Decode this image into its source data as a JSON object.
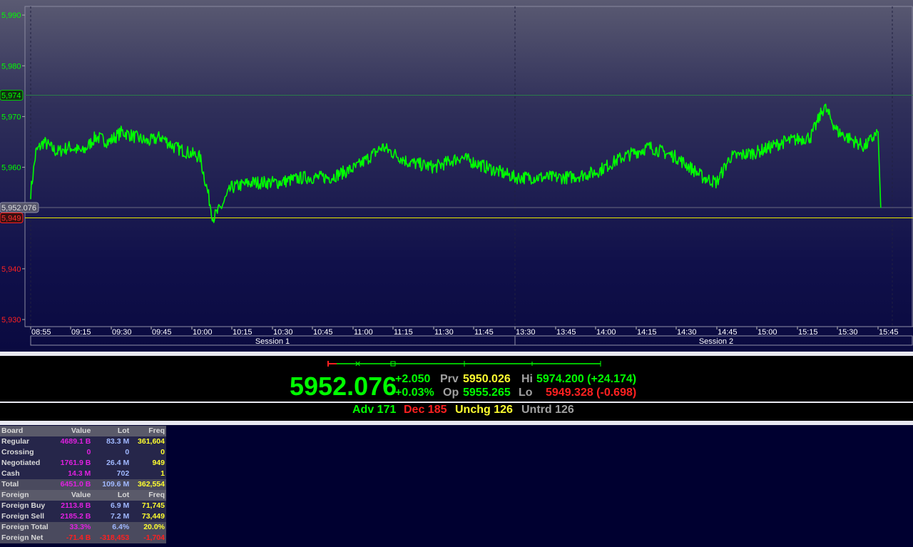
{
  "chart": {
    "y_ticks": [
      {
        "label": "5,990",
        "value": 5990,
        "color": "#00ff00"
      },
      {
        "label": "5,980",
        "value": 5980,
        "color": "#00ff00"
      },
      {
        "label": "5,970",
        "value": 5970,
        "color": "#00ff00"
      },
      {
        "label": "5,960",
        "value": 5960,
        "color": "#00ff00"
      },
      {
        "label": "5,940",
        "value": 5940,
        "color": "#ff2020"
      },
      {
        "label": "5,930",
        "value": 5930,
        "color": "#ff2020"
      }
    ],
    "markers": {
      "high": {
        "label": "5,974",
        "value": 5974.2
      },
      "last": {
        "label": "5,952.076",
        "value": 5952.076
      },
      "prev": {
        "label": "5,949",
        "value": 5950.026
      }
    },
    "x_ticks": [
      "08:55",
      "09:15",
      "09:30",
      "09:45",
      "10:00",
      "10:15",
      "10:30",
      "10:45",
      "11:00",
      "11:15",
      "11:30",
      "11:45",
      "13:30",
      "13:45",
      "14:00",
      "14:15",
      "14:30",
      "14:45",
      "15:00",
      "15:15",
      "15:30",
      "15:45"
    ],
    "sessions": [
      "Session 1",
      "Session 2"
    ],
    "line_color": "#00ff00",
    "series_points": [
      [
        "08:55",
        5955
      ],
      [
        "08:57",
        5963
      ],
      [
        "09:00",
        5965
      ],
      [
        "09:05",
        5963
      ],
      [
        "09:10",
        5964
      ],
      [
        "09:15",
        5963
      ],
      [
        "09:20",
        5966
      ],
      [
        "09:25",
        5965
      ],
      [
        "09:30",
        5967
      ],
      [
        "09:35",
        5966
      ],
      [
        "09:40",
        5965
      ],
      [
        "09:45",
        5966
      ],
      [
        "09:50",
        5964
      ],
      [
        "09:55",
        5963
      ],
      [
        "10:00",
        5962
      ],
      [
        "10:03",
        5955
      ],
      [
        "10:05",
        5950
      ],
      [
        "10:08",
        5952
      ],
      [
        "10:12",
        5956
      ],
      [
        "10:20",
        5957
      ],
      [
        "10:30",
        5957
      ],
      [
        "10:40",
        5958
      ],
      [
        "10:50",
        5958
      ],
      [
        "11:00",
        5960
      ],
      [
        "11:10",
        5964
      ],
      [
        "11:20",
        5961
      ],
      [
        "11:30",
        5960
      ],
      [
        "11:40",
        5962
      ],
      [
        "11:50",
        5960
      ],
      [
        "13:30",
        5958
      ],
      [
        "13:40",
        5958
      ],
      [
        "13:50",
        5958
      ],
      [
        "14:00",
        5959
      ],
      [
        "14:10",
        5962
      ],
      [
        "14:20",
        5964
      ],
      [
        "14:30",
        5962
      ],
      [
        "14:40",
        5958
      ],
      [
        "14:45",
        5957
      ],
      [
        "14:50",
        5962
      ],
      [
        "15:00",
        5963
      ],
      [
        "15:10",
        5965
      ],
      [
        "15:20",
        5966
      ],
      [
        "15:25",
        5972
      ],
      [
        "15:30",
        5967
      ],
      [
        "15:40",
        5964
      ],
      [
        "15:45",
        5967
      ],
      [
        "15:46",
        5952
      ]
    ]
  },
  "index": {
    "last": "5952.076",
    "chg": "+2.050",
    "pct": "+0.03%",
    "prv_label": "Prv",
    "prv_value": "5950.026",
    "op_label": "Op",
    "op_value": "5955.265",
    "hi_label": "Hi",
    "hi_value": "5974.200 (+24.174)",
    "lo_label": "Lo",
    "lo_value": "5949.328 (-0.698)"
  },
  "breadth": {
    "adv": "Adv 171",
    "dec": "Dec 185",
    "unchg": "Unchg 126",
    "untrd": "Untrd 126"
  },
  "stats": {
    "header1": [
      "Board",
      "Value",
      "Lot",
      "Freq"
    ],
    "rows1": [
      [
        "Regular",
        "4689.1 B",
        "83.3 M",
        "361,604"
      ],
      [
        "Crossing",
        "0",
        "0",
        "0"
      ],
      [
        "Negotiated",
        "1761.9 B",
        "26.4 M",
        "949"
      ],
      [
        "Cash",
        "14.3 M",
        "702",
        "1"
      ]
    ],
    "total1": [
      "Total",
      "6451.0 B",
      "109.6 M",
      "362,554"
    ],
    "header2": [
      "Foreign",
      "Value",
      "Lot",
      "Freq"
    ],
    "rows2": [
      [
        "Foreign Buy",
        "2113.8 B",
        "6.9 M",
        "71,745"
      ],
      [
        "Foreign Sell",
        "2185.2 B",
        "7.2 M",
        "73,449"
      ],
      [
        "Foreign Total",
        "33.3%",
        "6.4%",
        "20.0%"
      ]
    ],
    "net": [
      "Foreign Net",
      "-71.4 B",
      "-318,453",
      "-1,704"
    ]
  }
}
